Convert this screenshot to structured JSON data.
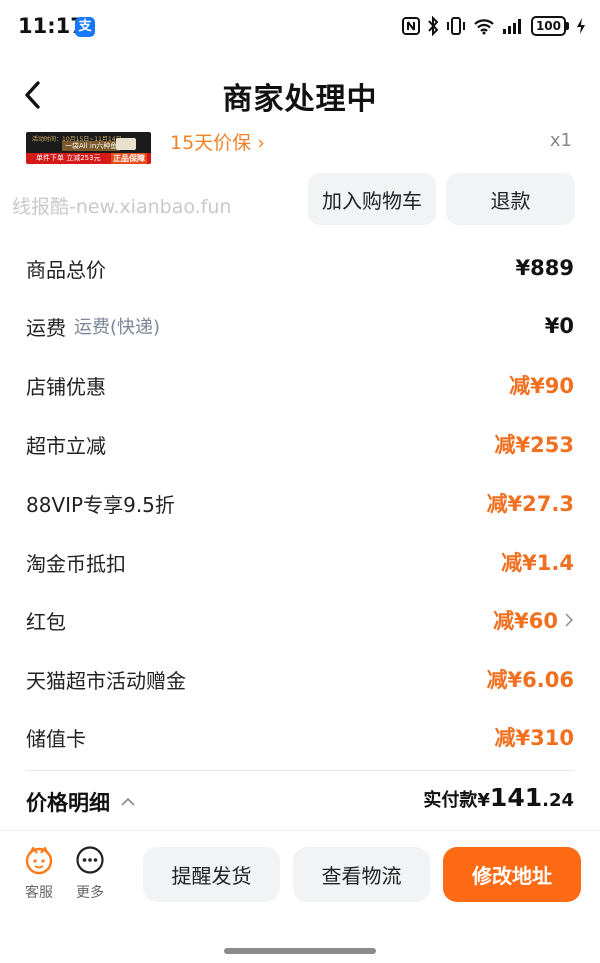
{
  "status_bar": {
    "time": "11:17",
    "alipay_badge": "支",
    "battery": "100"
  },
  "header": {
    "title": "商家处理中"
  },
  "product": {
    "image_top_text": "活动时间：10月15日~11月14日",
    "image_mid_text": "一袋All in六种鱼",
    "image_bottom_text": "单件下单 立减253元",
    "image_badge": "正品保障",
    "price_protect": "15天价保 ›",
    "quantity": "x1"
  },
  "watermark": "线报酷-new.xianbao.fun",
  "actions": {
    "add_to_cart": "加入购物车",
    "refund": "退款"
  },
  "price_rows": [
    {
      "label": "商品总价",
      "sub": "",
      "value": "¥889",
      "highlight": false
    },
    {
      "label": "运费",
      "sub": "运费(快递)",
      "value": "¥0",
      "highlight": false
    },
    {
      "label": "店铺优惠",
      "sub": "",
      "value": "减¥90",
      "highlight": true
    },
    {
      "label": "超市立减",
      "sub": "",
      "value": "减¥253",
      "highlight": true
    },
    {
      "label": "88VIP专享9.5折",
      "sub": "",
      "value": "减¥27.3",
      "highlight": true
    },
    {
      "label": "淘金币抵扣",
      "sub": "",
      "value": "减¥1.4",
      "highlight": true
    },
    {
      "label": "红包",
      "sub": "",
      "value": "减¥60",
      "highlight": true
    },
    {
      "label": "天猫超市活动赠金",
      "sub": "",
      "value": "减¥6.06",
      "highlight": true
    },
    {
      "label": "储值卡",
      "sub": "",
      "value": "减¥310",
      "highlight": true
    }
  ],
  "summary": {
    "detail_label": "价格明细",
    "actual_label": "实付款¥",
    "actual_int": "141",
    "actual_dec": ".24"
  },
  "bottom_bar": {
    "customer_service": "客服",
    "more": "更多",
    "remind_ship": "提醒发货",
    "view_logistics": "查看物流",
    "change_address": "修改地址"
  },
  "colors": {
    "accent_orange": "#ff6a14",
    "discount_orange": "#f07020",
    "button_grey": "#f1f3f5"
  }
}
